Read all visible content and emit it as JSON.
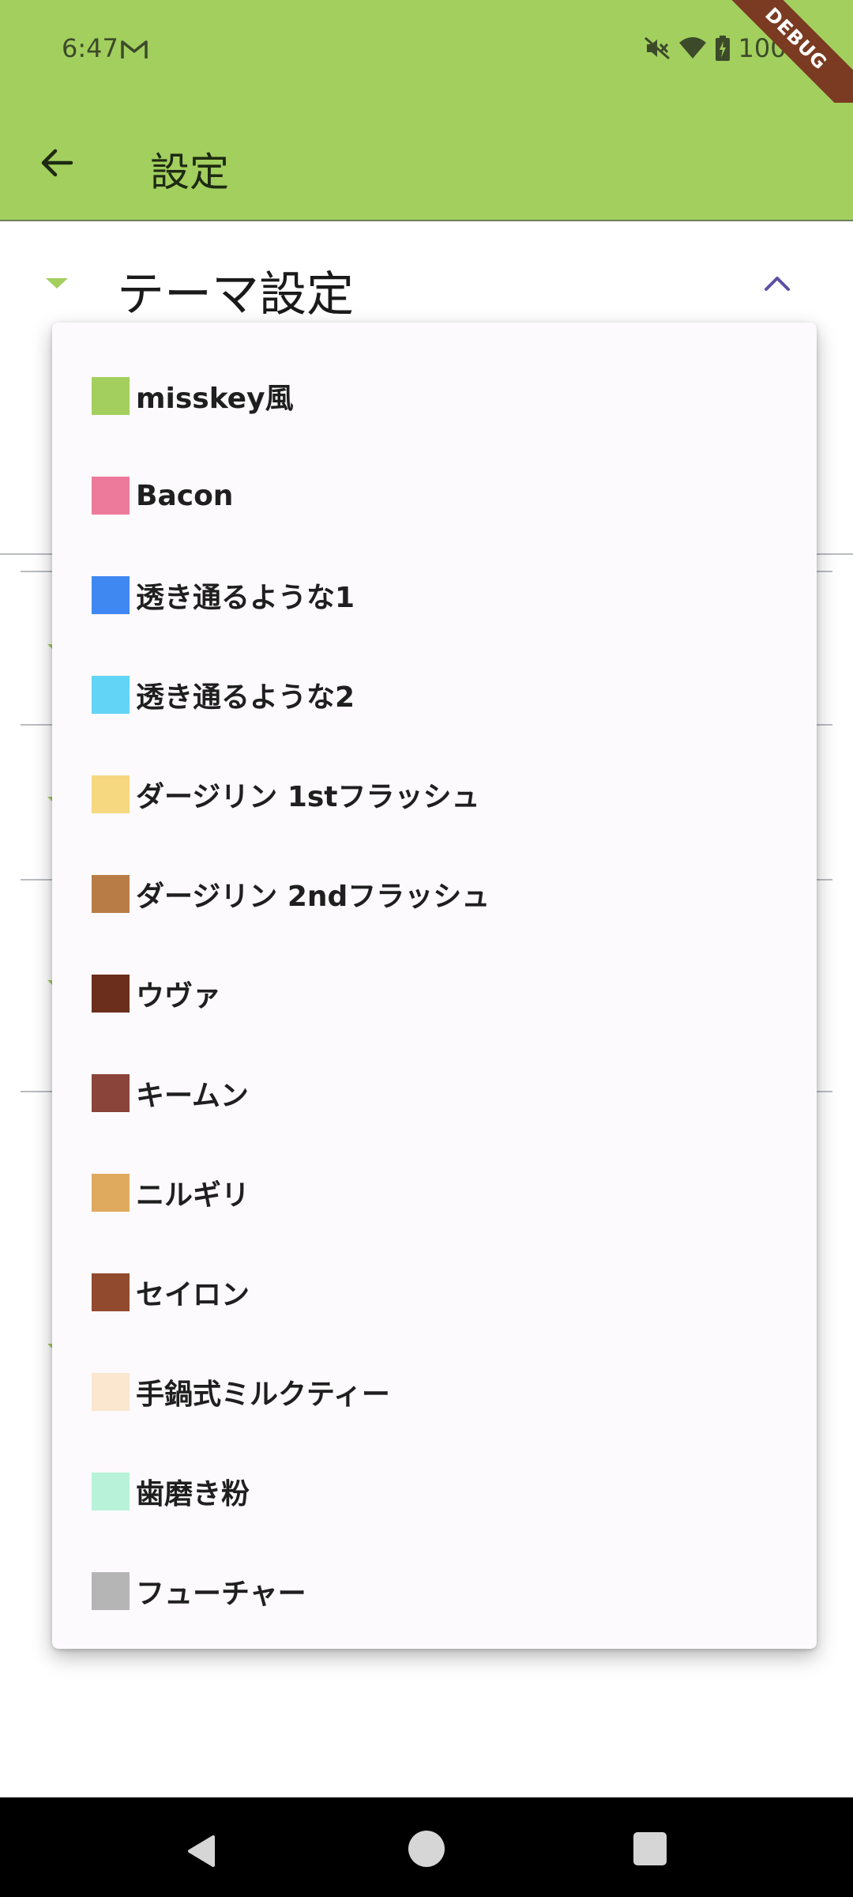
{
  "status_bar": {
    "time": "6:47",
    "battery": "100%",
    "icons": [
      "gmail-icon",
      "mute-icon",
      "wifi-icon",
      "battery-charging-icon"
    ]
  },
  "debug_banner": "DEBUG",
  "app_bar": {
    "title": "設定",
    "back_icon": "arrow-back-icon"
  },
  "theme_section": {
    "title": "テーマ設定",
    "collapse_icon": "chevron-up-icon"
  },
  "dropdown": {
    "options": [
      {
        "label": "misskey風",
        "color": "#a2cf5e"
      },
      {
        "label": "Bacon",
        "color": "#ee7a9b"
      },
      {
        "label": "透き通るような1",
        "color": "#3f88f2"
      },
      {
        "label": "透き通るような2",
        "color": "#62d4f6"
      },
      {
        "label": "ダージリン 1stフラッシュ",
        "color": "#f5d880"
      },
      {
        "label": "ダージリン 2ndフラッシュ",
        "color": "#b87d46"
      },
      {
        "label": "ウヴァ",
        "color": "#6b2e1c"
      },
      {
        "label": "キームン",
        "color": "#8b443a"
      },
      {
        "label": "ニルギリ",
        "color": "#e0aa5e"
      },
      {
        "label": "セイロン",
        "color": "#924a2e"
      },
      {
        "label": "手鍋式ミルクティー",
        "color": "#fbe6cf"
      },
      {
        "label": "歯磨き粉",
        "color": "#b7f2d9"
      },
      {
        "label": "フューチャー",
        "color": "#b5b5b5"
      }
    ]
  },
  "nav_bar": {
    "icons": [
      "nav-back-icon",
      "nav-home-icon",
      "nav-recents-icon"
    ]
  }
}
